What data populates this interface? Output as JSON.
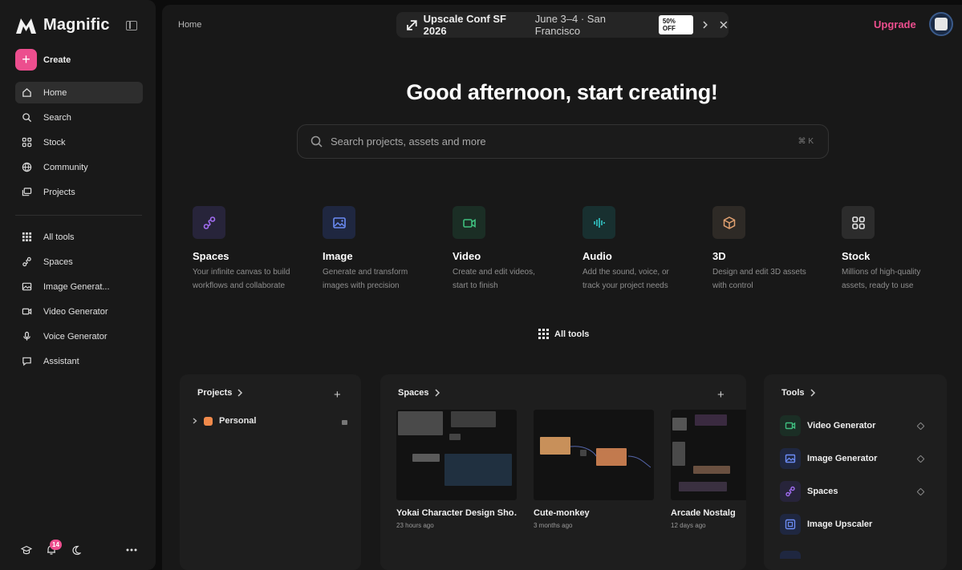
{
  "brand": {
    "name": "Magnific"
  },
  "sidebar": {
    "create_label": "Create",
    "primary": [
      {
        "label": "Home",
        "icon": "home-icon"
      },
      {
        "label": "Search",
        "icon": "search-icon"
      },
      {
        "label": "Stock",
        "icon": "grid-icon"
      },
      {
        "label": "Community",
        "icon": "globe-icon"
      },
      {
        "label": "Projects",
        "icon": "folders-icon"
      }
    ],
    "secondary": [
      {
        "label": "All tools",
        "icon": "apps-icon"
      },
      {
        "label": "Spaces",
        "icon": "spaces-icon"
      },
      {
        "label": "Image Generat...",
        "icon": "image-icon"
      },
      {
        "label": "Video Generator",
        "icon": "video-icon"
      },
      {
        "label": "Voice Generator",
        "icon": "microphone-icon"
      },
      {
        "label": "Assistant",
        "icon": "chat-icon"
      }
    ],
    "notifications_count": "14"
  },
  "header": {
    "breadcrumb": "Home",
    "banner": {
      "title": "Upscale Conf SF 2026",
      "details": "June 3–4 · San Francisco",
      "badge": "50% OFF"
    },
    "upgrade_label": "Upgrade"
  },
  "hero": {
    "title": "Good afternoon, start creating!"
  },
  "search": {
    "placeholder": "Search projects, assets and more",
    "shortcut": "⌘ K"
  },
  "categories": [
    {
      "title": "Spaces",
      "desc": "Your infinite canvas to build workflows and collaborate",
      "color": "#a26df2",
      "bg": "#27243a"
    },
    {
      "title": "Image",
      "desc": "Generate and transform images with precision",
      "color": "#6b8cf5",
      "bg": "#1f2740"
    },
    {
      "title": "Video",
      "desc": "Create and edit videos, start to finish",
      "color": "#3fbf7f",
      "bg": "#1b2e25"
    },
    {
      "title": "Audio",
      "desc": "Add the sound, voice, or track your project needs",
      "color": "#33c9c9",
      "bg": "#183030"
    },
    {
      "title": "3D",
      "desc": "Design and edit 3D assets with control",
      "color": "#e0a070",
      "bg": "#2e2a26"
    },
    {
      "title": "Stock",
      "desc": "Millions of high-quality assets, ready to use",
      "color": "#e6e6e6",
      "bg": "#2c2c2c"
    }
  ],
  "all_tools_label": "All tools",
  "projects_panel": {
    "title": "Projects",
    "items": [
      {
        "label": "Personal"
      }
    ]
  },
  "spaces_panel": {
    "title": "Spaces",
    "items": [
      {
        "title": "Yokai Character Design Sho…",
        "time": "23 hours ago"
      },
      {
        "title": "Cute-monkey",
        "time": "3 months ago"
      },
      {
        "title": "Arcade Nostalg",
        "time": "12 days ago"
      }
    ]
  },
  "tools_panel": {
    "title": "Tools",
    "items": [
      {
        "label": "Video Generator",
        "color": "#3fbf7f",
        "bg": "#1b2e25"
      },
      {
        "label": "Image Generator",
        "color": "#6b8cf5",
        "bg": "#1f2740"
      },
      {
        "label": "Spaces",
        "color": "#a26df2",
        "bg": "#27243a"
      },
      {
        "label": "Image Upscaler",
        "color": "#6b8cf5",
        "bg": "#1f2740"
      }
    ]
  }
}
